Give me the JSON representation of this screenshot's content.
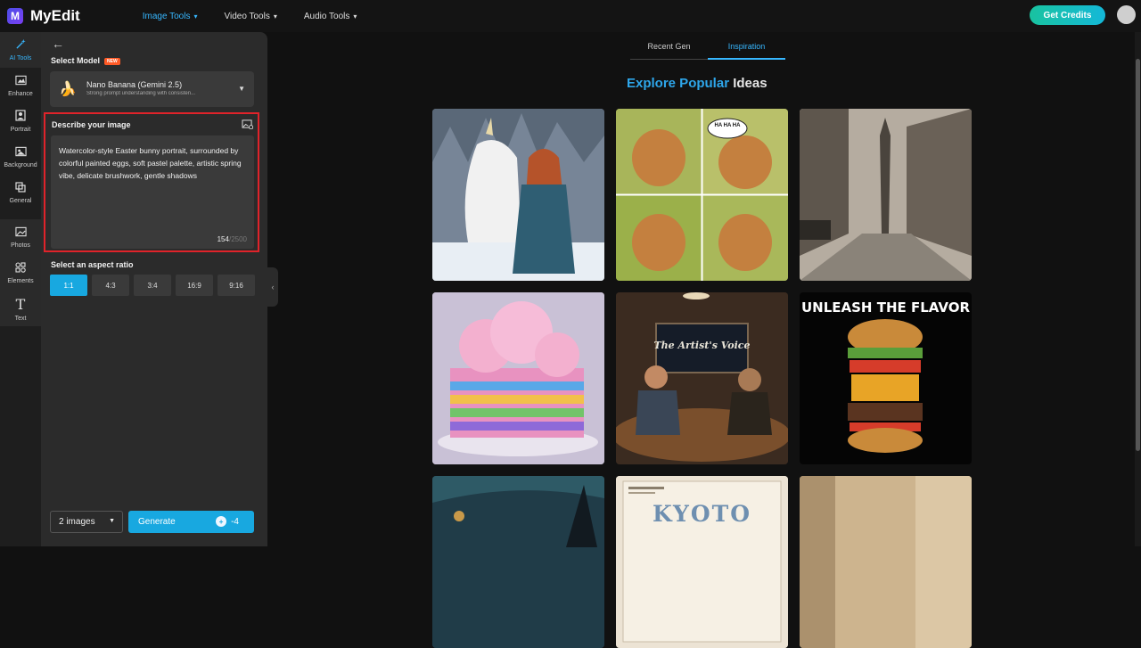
{
  "app": {
    "name": "MyEdit",
    "logo_glyph": "M"
  },
  "nav": {
    "items": [
      {
        "label": "Image Tools"
      },
      {
        "label": "Video Tools"
      },
      {
        "label": "Audio Tools"
      }
    ]
  },
  "header": {
    "credits_label": "Get Credits"
  },
  "rail": {
    "items": [
      {
        "label": "AI Tools",
        "icon": "magic-wand-icon"
      },
      {
        "label": "Enhance",
        "icon": "enhance-icon"
      },
      {
        "label": "Portrait",
        "icon": "portrait-icon"
      },
      {
        "label": "Background",
        "icon": "background-icon"
      },
      {
        "label": "General",
        "icon": "general-icon"
      },
      {
        "label": "Photos",
        "icon": "photos-icon"
      },
      {
        "label": "Elements",
        "icon": "elements-icon"
      },
      {
        "label": "Text",
        "icon": "text-icon"
      }
    ]
  },
  "panel": {
    "select_model_label": "Select Model",
    "new_badge": "NEW",
    "model": {
      "name": "Nano Banana (Gemini 2.5)",
      "description": "Strong prompt understanding with consisten..."
    },
    "prompt": {
      "title": "Describe your image",
      "text": "Watercolor-style Easter bunny portrait, surrounded by colorful painted eggs, soft pastel palette, artistic spring vibe, delicate brushwork, gentle shadows",
      "count": "154",
      "max": "/2500"
    },
    "aspect_label": "Select an aspect ratio",
    "ratios": [
      "1:1",
      "4:3",
      "3:4",
      "16:9",
      "9:16"
    ],
    "count_select": "2 images",
    "generate_label": "Generate",
    "generate_cost": "-4"
  },
  "tabs": [
    {
      "label": "Recent Gen"
    },
    {
      "label": "Inspiration"
    }
  ],
  "explore": {
    "title_highlight": "Explore Popular",
    "title_rest": " Ideas"
  },
  "thumbnails": {
    "speech_bubble": "HA HA HA",
    "burger_title": "UNLEASH THE FLAVOR",
    "artist_sign": "The Artist's Voice",
    "kyoto": "KYOTO"
  }
}
